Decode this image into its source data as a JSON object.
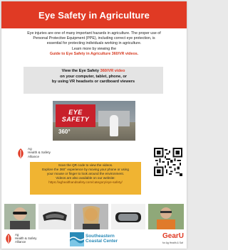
{
  "title": "Eye Safety in Agriculture",
  "intro": {
    "line1": "Eye injuries are one of many important hazards in agriculture. The proper use of",
    "line2": "Personal Protective Equipment (PPE), including correct eye protection, is",
    "line3": "essential for protecting individuals working in agriculture.",
    "line4": "Learn more by viewing the",
    "guide_link": "Guide to Eye Safety in Agriculture 360/VR videos."
  },
  "view_box": {
    "line1_pre": "View the Eye Safety ",
    "line1_vr": "360/VR video",
    "line2": "on your computer, tablet, phone, or",
    "line3": "by using VR headsets or cardboard viewers"
  },
  "video_thumb": {
    "safety_word1": "EYE",
    "safety_word2": "SAFETY",
    "badge": "360°"
  },
  "ag_logo": {
    "line1": "Ag",
    "line2": "Health & Safety",
    "line3": "Alliance"
  },
  "scan_box": {
    "line1": "Scan the QR code to view the videos.",
    "line2": "Explore the 360° experience by moving your phone or using",
    "line3": "your mouse or finger to look around the environment.",
    "line4": "Videos are also available on our website:",
    "url": "https://aghealthandsafety.com/category/eye-safety/"
  },
  "footer": {
    "coastal_line1": "Southeastern",
    "coastal_line2": "Coastal Center",
    "gear_big": "GearU",
    "gear_small": "for Ag Health & Saf"
  },
  "colors": {
    "brand_red": "#e03a24",
    "scan_yellow": "#f0b432",
    "coastal_blue": "#2a8ab7"
  },
  "icons": [
    "ag-leaf-icon",
    "qr-code",
    "wave-icon"
  ]
}
